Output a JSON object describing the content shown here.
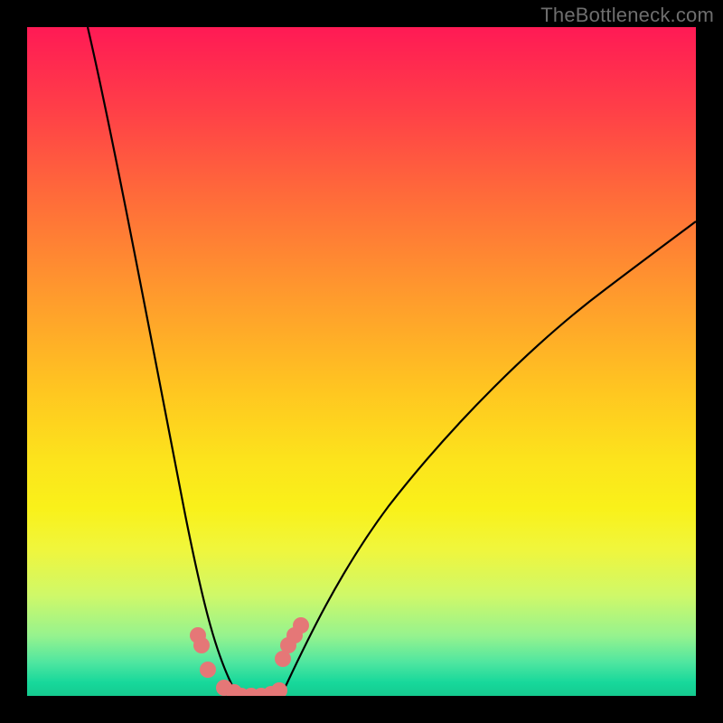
{
  "watermark": "TheBottleneck.com",
  "chart_data": {
    "type": "line",
    "title": "",
    "xlabel": "",
    "ylabel": "",
    "xlim": [
      0,
      100
    ],
    "ylim": [
      0,
      100
    ],
    "series": [
      {
        "name": "left-curve",
        "x": [
          9,
          12,
          15,
          18,
          21,
          24,
          25.5,
          27,
          28.5,
          30,
          31.5
        ],
        "values": [
          100,
          85,
          68,
          50,
          32,
          15,
          9,
          5,
          2.5,
          0.8,
          0
        ]
      },
      {
        "name": "right-curve",
        "x": [
          38,
          40,
          43,
          47,
          52,
          58,
          65,
          73,
          82,
          91,
          100
        ],
        "values": [
          0,
          3,
          8,
          15,
          23,
          32,
          41,
          50,
          58,
          65,
          71
        ]
      },
      {
        "name": "markers-left",
        "x": [
          25.5,
          26,
          27,
          29.5,
          31
        ],
        "values": [
          9,
          7.5,
          4,
          1.2,
          0.5
        ]
      },
      {
        "name": "markers-valley",
        "x": [
          32,
          33.5,
          35,
          36.5,
          37.6
        ],
        "values": [
          0,
          0,
          0,
          0.3,
          0.8
        ]
      },
      {
        "name": "markers-right",
        "x": [
          38.2,
          39,
          40,
          41
        ],
        "values": [
          5.5,
          7.5,
          9,
          10.5
        ]
      }
    ]
  }
}
